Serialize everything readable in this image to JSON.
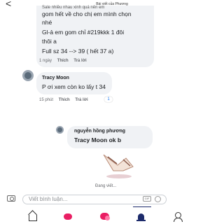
{
  "header": {
    "back": "<",
    "title": "Bài viết của Phương"
  },
  "comment1": {
    "lines": [
      "Sale nhiều nhau xinh quá nên em",
      "gom hết về cho chị em mình chọn",
      "nhé",
      "Gl-ả em gom chỉ #219kkk 1 đôi",
      "thôi a",
      "Full sz 34 --> 39 ( hết 37 a)"
    ],
    "meta": {
      "time": "1 ngày",
      "like": "Thích",
      "reply": "Trả lời"
    }
  },
  "comment2": {
    "author": "Tracy Moon",
    "text": "P ơi xem còn ko lấy t 34",
    "meta": {
      "time": "15 phút",
      "like": "Thích",
      "reply": "Trả lời",
      "count": "1"
    }
  },
  "comment3": {
    "author": "nguyễn hồng phương",
    "text": "Tracy Moon ok b"
  },
  "typing": "Đang viết...",
  "composer": {
    "placeholder": "Viết bình luận...",
    "gif": "GIF"
  },
  "colors": {
    "bubble": "#f0f2f5",
    "accent_pink": "#e91e63",
    "nav_active": "#1d2b6b"
  }
}
